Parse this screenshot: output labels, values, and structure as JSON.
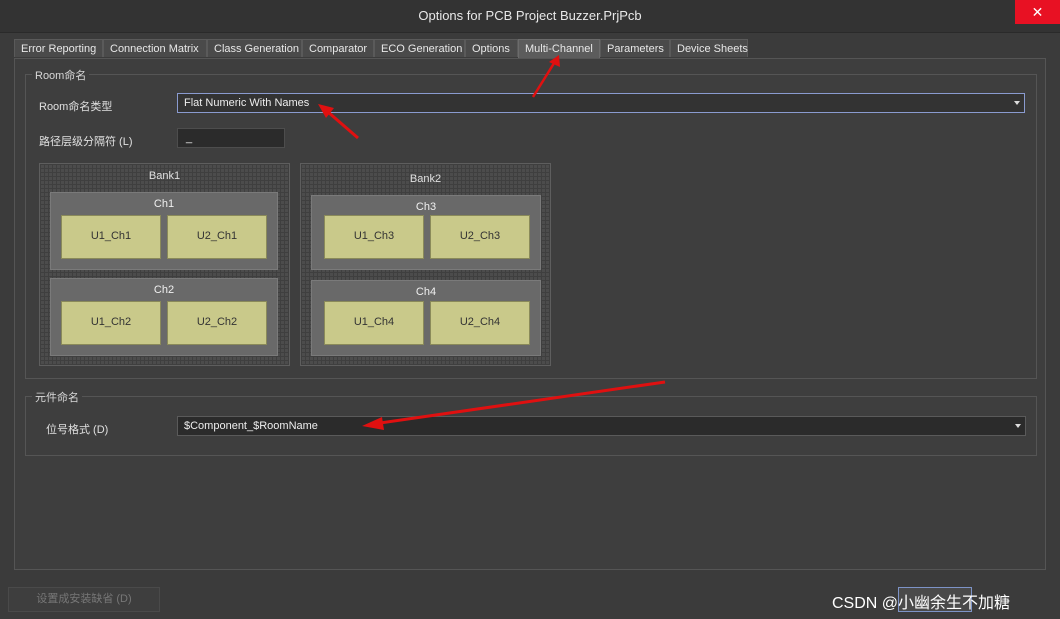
{
  "window": {
    "title": "Options for PCB Project Buzzer.PrjPcb",
    "close_glyph": "✕"
  },
  "tabs": [
    {
      "label": "Error Reporting"
    },
    {
      "label": "Connection Matrix"
    },
    {
      "label": "Class Generation"
    },
    {
      "label": "Comparator"
    },
    {
      "label": "ECO Generation"
    },
    {
      "label": "Options"
    },
    {
      "label": "Multi-Channel",
      "active": true
    },
    {
      "label": "Parameters"
    },
    {
      "label": "Device Sheets"
    }
  ],
  "room_naming": {
    "group_label": "Room命名",
    "type_label": "Room命名类型",
    "type_value": "Flat Numeric With Names",
    "separator_label": "路径层级分隔符 (L)",
    "separator_value": "_",
    "preview": {
      "banks": [
        {
          "name": "Bank1",
          "channels": [
            {
              "name": "Ch1",
              "components": [
                "U1_Ch1",
                "U2_Ch1"
              ]
            },
            {
              "name": "Ch2",
              "components": [
                "U1_Ch2",
                "U2_Ch2"
              ]
            }
          ]
        },
        {
          "name": "Bank2",
          "channels": [
            {
              "name": "Ch3",
              "components": [
                "U1_Ch3",
                "U2_Ch3"
              ]
            },
            {
              "name": "Ch4",
              "components": [
                "U1_Ch4",
                "U2_Ch4"
              ]
            }
          ]
        }
      ]
    }
  },
  "component_naming": {
    "group_label": "元件命名",
    "designator_label": "位号格式 (D)",
    "designator_value": "$Component_$RoomName"
  },
  "footer": {
    "set_default_label": "设置成安装缺省 (D)",
    "watermark": "CSDN @小幽余生不加糖"
  },
  "colors": {
    "annotation_arrow": "#e01010",
    "close_button": "#e81123",
    "component_fill": "#c9c98a"
  }
}
